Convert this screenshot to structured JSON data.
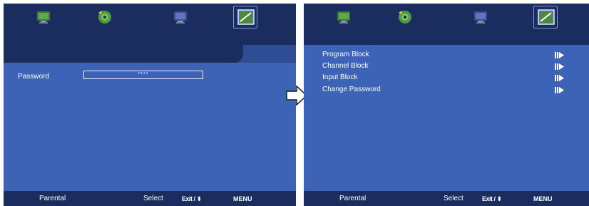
{
  "colors": {
    "panel_bg": "#3d63b7",
    "dark_bar": "#1a2d5e",
    "text": "#ffffff"
  },
  "tabs": [
    {
      "icon": "picture-tv-icon"
    },
    {
      "icon": "sound-disc-icon"
    },
    {
      "icon": "tv-setup-icon"
    },
    {
      "icon": "parental-lock-icon",
      "selected": true
    }
  ],
  "left_screen": {
    "password_label": "Password",
    "password_value": "****",
    "status": {
      "title": "Parental",
      "select": "Select",
      "exit": "Exit / ⬍",
      "menu": "MENU"
    }
  },
  "right_screen": {
    "items": [
      {
        "label": "Program Block"
      },
      {
        "label": "Channel Block"
      },
      {
        "label": "Input Block"
      },
      {
        "label": "Change Password"
      }
    ],
    "status": {
      "title": "Parental",
      "select": "Select",
      "exit": "Exit / ⬍",
      "menu": "MENU"
    }
  }
}
